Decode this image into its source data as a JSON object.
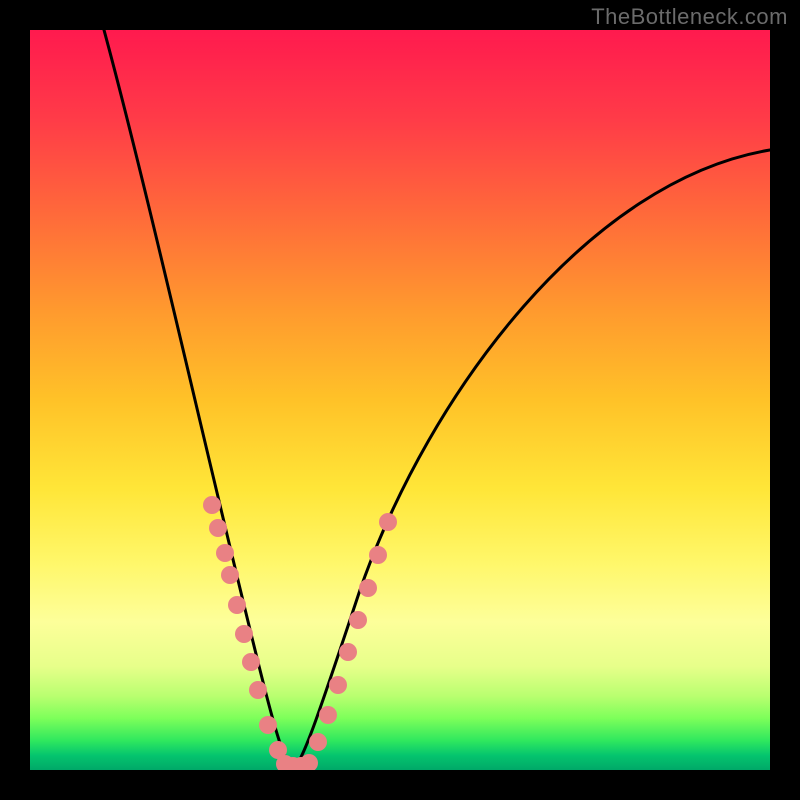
{
  "watermark": {
    "text": "TheBottleneck.com"
  },
  "chart_data": {
    "type": "line",
    "title": "",
    "xlabel": "",
    "ylabel": "",
    "xlim": [
      0,
      100
    ],
    "ylim": [
      0,
      100
    ],
    "grid": false,
    "legend": false,
    "background": {
      "type": "vertical-gradient",
      "stops": [
        {
          "pos": 0,
          "color": "#ff1a4e"
        },
        {
          "pos": 50,
          "color": "#ffc228"
        },
        {
          "pos": 80,
          "color": "#fdff9a"
        },
        {
          "pos": 100,
          "color": "#00a868"
        }
      ]
    },
    "series": [
      {
        "name": "curve",
        "color": "#000000",
        "x": [
          10,
          14,
          18,
          22,
          25,
          28,
          30,
          32,
          34,
          36,
          40,
          44,
          48,
          55,
          62,
          70,
          78,
          86,
          94,
          100
        ],
        "y": [
          100,
          80,
          62,
          46,
          34,
          23,
          15,
          8,
          3,
          0,
          3,
          10,
          20,
          36,
          50,
          62,
          71,
          77,
          81,
          83
        ]
      }
    ],
    "markers": [
      {
        "name": "left-dots",
        "color": "#e98184",
        "x": [
          23.5,
          24.3,
          25.2,
          26.0,
          27.0,
          28.0,
          29.0,
          30.0,
          31.5,
          33.0
        ],
        "y": [
          40,
          36,
          32,
          29,
          24,
          20,
          16,
          12,
          7,
          3
        ]
      },
      {
        "name": "right-dots",
        "color": "#e98184",
        "x": [
          38.5,
          40.0,
          41.5,
          43.0,
          44.5,
          46.0,
          47.5,
          49.0
        ],
        "y": [
          3,
          7,
          12,
          17,
          22,
          27,
          32,
          37
        ]
      },
      {
        "name": "bottom-dots",
        "color": "#e98184",
        "x": [
          34.0,
          35.0,
          36.0,
          37.0
        ],
        "y": [
          0.5,
          0.5,
          0.5,
          0.5
        ]
      }
    ]
  }
}
